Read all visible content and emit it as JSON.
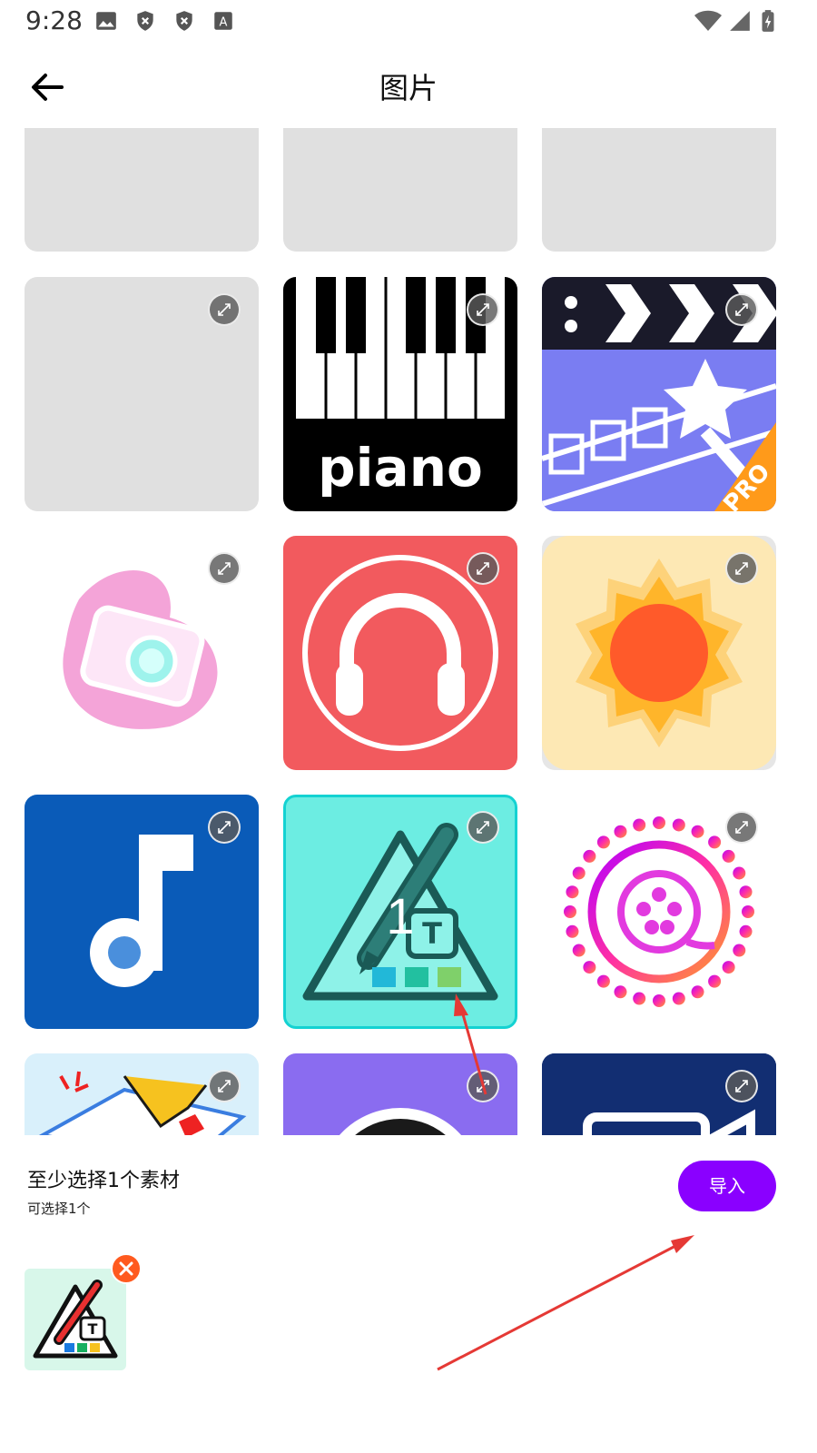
{
  "status_bar": {
    "time": "9:28",
    "left_icons": [
      "image-icon",
      "shield-x-icon",
      "shield-x-icon",
      "text-a-icon"
    ],
    "right_icons": [
      "wifi-icon",
      "signal-icon",
      "battery-charging-icon"
    ]
  },
  "header": {
    "title": "图片",
    "back_icon": "arrow-left-icon"
  },
  "grid": {
    "tiles": [
      {
        "name": "placeholder",
        "selected": false
      },
      {
        "name": "placeholder",
        "selected": false
      },
      {
        "name": "placeholder",
        "selected": false
      },
      {
        "name": "placeholder",
        "selected": false
      },
      {
        "name": "piano-app",
        "label": "piano",
        "selected": false
      },
      {
        "name": "video-editor-pro",
        "label": "PRO",
        "selected": false
      },
      {
        "name": "pink-camera",
        "selected": false
      },
      {
        "name": "headphones",
        "selected": false
      },
      {
        "name": "sun",
        "selected": false
      },
      {
        "name": "music-note",
        "selected": false
      },
      {
        "name": "text-pencil",
        "selected": true,
        "selection_number": "1"
      },
      {
        "name": "film-reel-ring",
        "selected": false
      },
      {
        "name": "toy-box",
        "selected": false
      },
      {
        "name": "camera-lens",
        "selected": false
      },
      {
        "name": "video-camera",
        "selected": false
      }
    ]
  },
  "panel": {
    "hint": "至少选择1个素材",
    "sub": "可选择1个",
    "import_label": "导入",
    "selected_thumb": "text-pencil",
    "remove_icon": "close-icon"
  },
  "colors": {
    "accent": "#8a00ff",
    "remove": "#ff5a1f",
    "selected_border": "#14d2d2",
    "annotation_arrow": "#e53935"
  }
}
